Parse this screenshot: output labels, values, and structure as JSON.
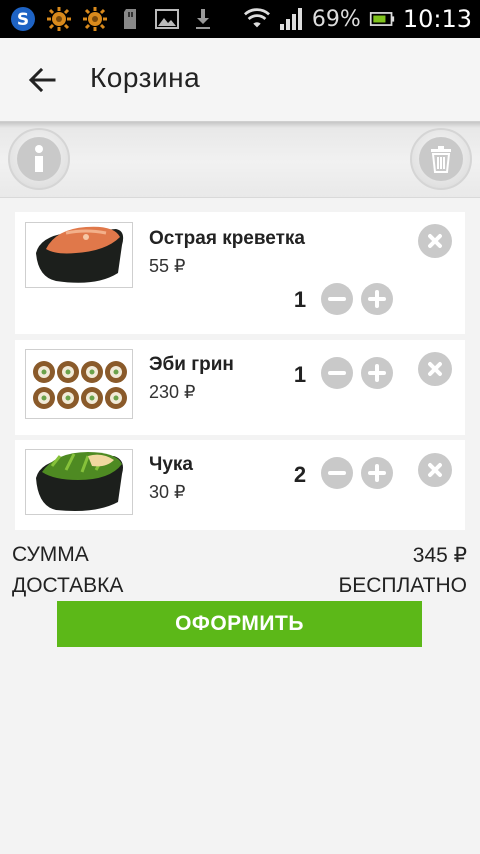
{
  "statusbar": {
    "battery_percent": "69%",
    "time": "10:13"
  },
  "appbar": {
    "title": "Корзина"
  },
  "cart": {
    "items": [
      {
        "name": "Острая креветка",
        "price": "55 ₽",
        "qty": "1"
      },
      {
        "name": "Эби грин",
        "price": "230 ₽",
        "qty": "1"
      },
      {
        "name": "Чука",
        "price": "30 ₽",
        "qty": "2"
      }
    ]
  },
  "summary": {
    "sum_label": "СУММА",
    "sum_value": "345 ₽",
    "delivery_label": "ДОСТАВКА",
    "delivery_value": "БЕСПЛАТНО"
  },
  "checkout_label": "ОФОРМИТЬ",
  "colors": {
    "accent": "#5cb818",
    "icon_gray": "#c9c9c9"
  }
}
